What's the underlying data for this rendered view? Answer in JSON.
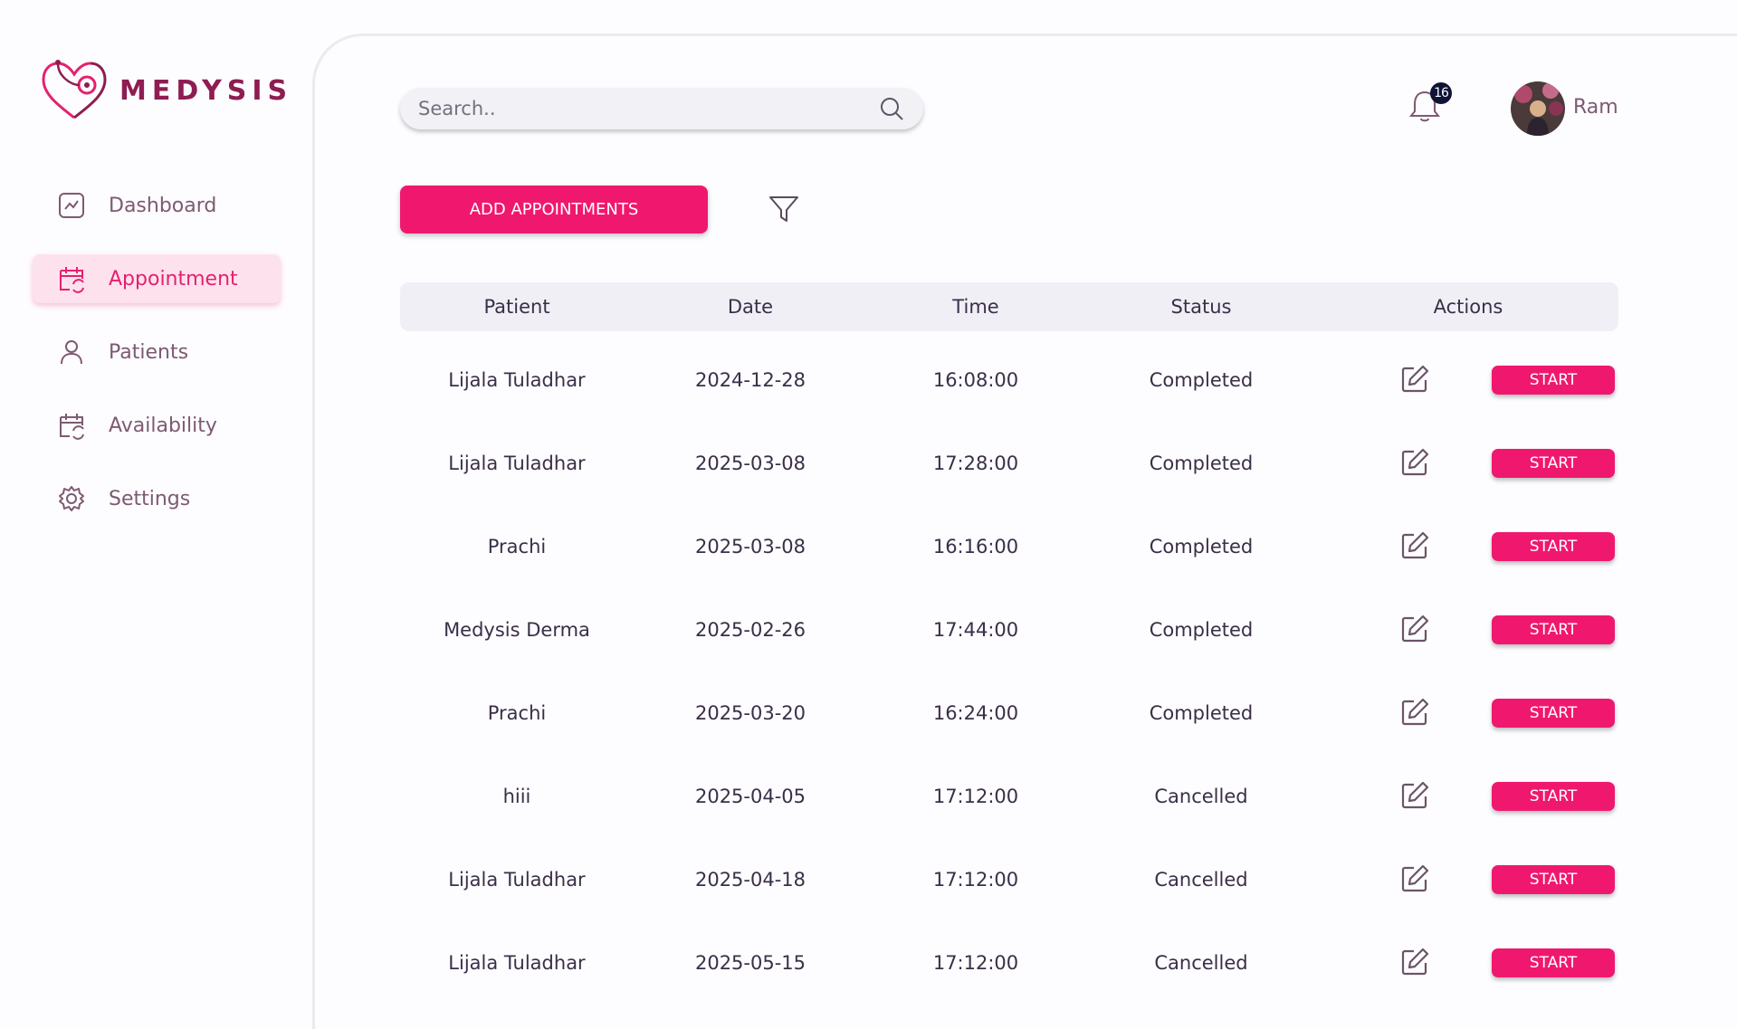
{
  "brand": {
    "name": "MEDYSIS",
    "logo_icon": "stethoscope-heart-icon"
  },
  "sidebar": {
    "items": [
      {
        "label": "Dashboard",
        "icon": "chart-icon",
        "active": false
      },
      {
        "label": "Appointment",
        "icon": "calendar-icon",
        "active": true
      },
      {
        "label": "Patients",
        "icon": "user-icon",
        "active": false
      },
      {
        "label": "Availability",
        "icon": "calendar-icon",
        "active": false
      },
      {
        "label": "Settings",
        "icon": "gear-icon",
        "active": false
      }
    ]
  },
  "header": {
    "search_placeholder": "Search..",
    "notification_count": "16",
    "user_name": "Ram"
  },
  "toolbar": {
    "add_label": "ADD APPOINTMENTS"
  },
  "table": {
    "columns": [
      "Patient",
      "Date",
      "Time",
      "Status",
      "Actions"
    ],
    "start_label": "START",
    "rows": [
      {
        "patient": "Lijala Tuladhar",
        "date": "2024-12-28",
        "time": "16:08:00",
        "status": "Completed"
      },
      {
        "patient": "Lijala Tuladhar",
        "date": "2025-03-08",
        "time": "17:28:00",
        "status": "Completed"
      },
      {
        "patient": "Prachi",
        "date": "2025-03-08",
        "time": "16:16:00",
        "status": "Completed"
      },
      {
        "patient": "Medysis Derma",
        "date": "2025-02-26",
        "time": "17:44:00",
        "status": "Completed"
      },
      {
        "patient": "Prachi",
        "date": "2025-03-20",
        "time": "16:24:00",
        "status": "Completed"
      },
      {
        "patient": "hiii",
        "date": "2025-04-05",
        "time": "17:12:00",
        "status": "Cancelled"
      },
      {
        "patient": "Lijala Tuladhar",
        "date": "2025-04-18",
        "time": "17:12:00",
        "status": "Cancelled"
      },
      {
        "patient": "Lijala Tuladhar",
        "date": "2025-05-15",
        "time": "17:12:00",
        "status": "Cancelled"
      }
    ]
  },
  "colors": {
    "accent": "#f0186e",
    "brand": "#8e1d52",
    "nav_text": "#7d5a72"
  }
}
